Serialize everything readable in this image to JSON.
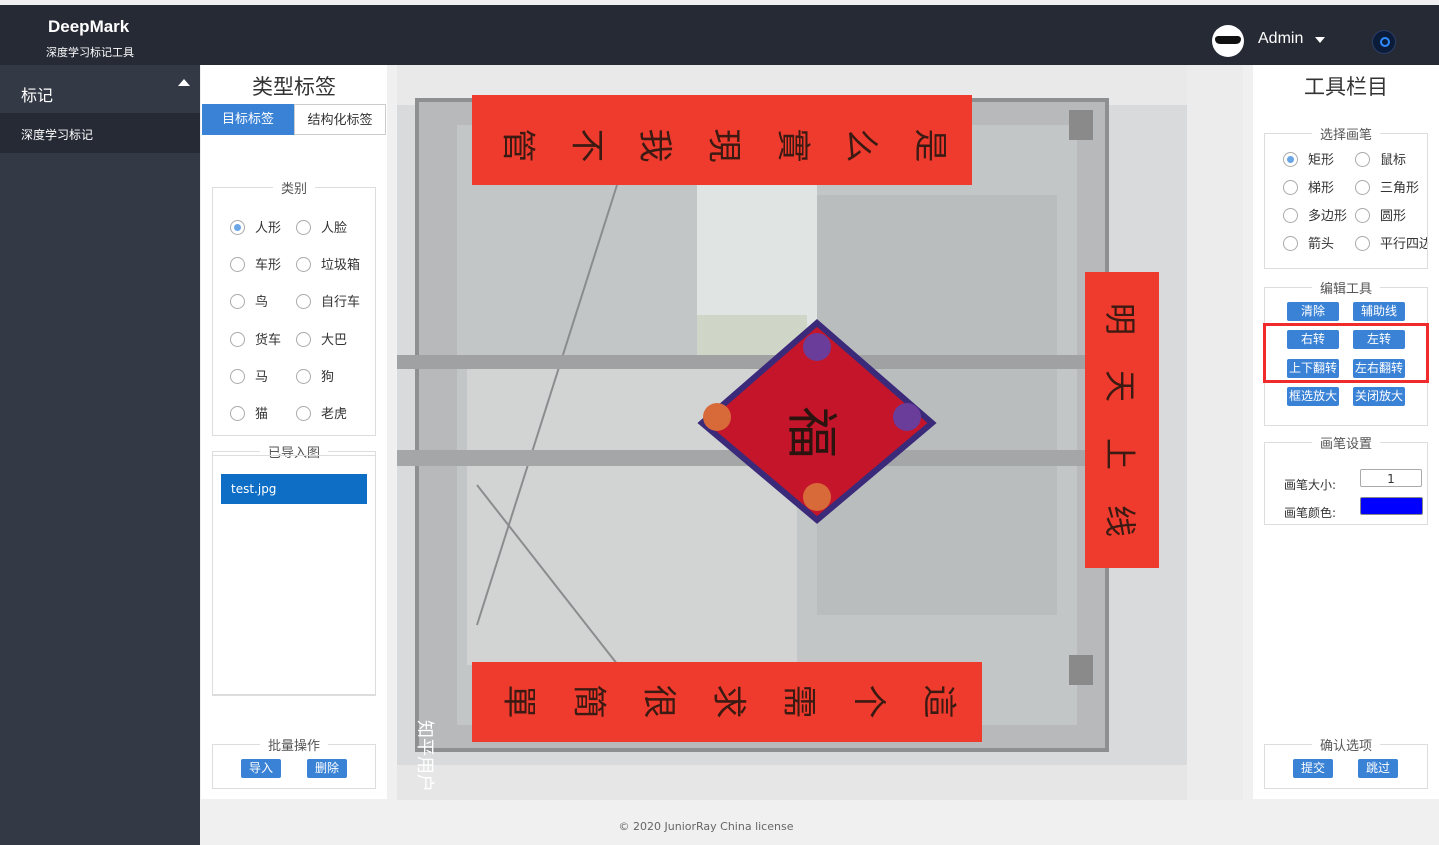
{
  "header": {
    "app_name": "DeepMark",
    "app_subtitle": "深度学习标记工具",
    "user_name": "Admin"
  },
  "sidebar": {
    "section_title": "标记",
    "items": [
      {
        "label": "深度学习标记"
      }
    ]
  },
  "left_panel": {
    "title": "类型标签",
    "tabs": [
      {
        "label": "目标标签",
        "active": true
      },
      {
        "label": "结构化标签",
        "active": false
      }
    ],
    "category_legend": "类别",
    "categories": [
      {
        "label": "人形",
        "checked": true
      },
      {
        "label": "人脸",
        "checked": false
      },
      {
        "label": "车形",
        "checked": false
      },
      {
        "label": "垃圾箱",
        "checked": false
      },
      {
        "label": "鸟",
        "checked": false
      },
      {
        "label": "自行车",
        "checked": false
      },
      {
        "label": "货车",
        "checked": false
      },
      {
        "label": "大巴",
        "checked": false
      },
      {
        "label": "马",
        "checked": false
      },
      {
        "label": "狗",
        "checked": false
      },
      {
        "label": "猫",
        "checked": false
      },
      {
        "label": "老虎",
        "checked": false
      }
    ],
    "imported_legend": "已导入图",
    "files": [
      {
        "name": "test.jpg",
        "selected": true
      }
    ],
    "batch_legend": "批量操作",
    "import_button": "导入",
    "delete_button": "删除"
  },
  "canvas": {
    "watermark": "知平用户",
    "couplet_top": [
      "是",
      "么",
      "實",
      "現",
      "我",
      "不",
      "管"
    ],
    "couplet_bottom": [
      "這",
      "个",
      "需",
      "求",
      "很",
      "簡",
      "單"
    ],
    "banner": [
      "明",
      "天",
      "上",
      "线"
    ],
    "fu_char": "福"
  },
  "right_panel": {
    "title": "工具栏目",
    "brush_legend": "选择画笔",
    "brushes": [
      {
        "label": "矩形",
        "checked": true
      },
      {
        "label": "鼠标",
        "checked": false
      },
      {
        "label": "梯形",
        "checked": false
      },
      {
        "label": "三角形",
        "checked": false
      },
      {
        "label": "多边形",
        "checked": false
      },
      {
        "label": "圆形",
        "checked": false
      },
      {
        "label": "箭头",
        "checked": false
      },
      {
        "label": "平行四边形",
        "checked": false
      }
    ],
    "edit_legend": "编辑工具",
    "edit_buttons": [
      "清除",
      "辅助线",
      "右转",
      "左转",
      "上下翻转",
      "左右翻转",
      "框选放大",
      "关闭放大"
    ],
    "pen_legend": "画笔设置",
    "pen_size_label": "画笔大小:",
    "pen_size_value": "1",
    "pen_color_label": "画笔颜色:",
    "pen_color": "#0000ff",
    "confirm_legend": "确认选项",
    "submit_button": "提交",
    "skip_button": "跳过"
  },
  "footer": {
    "text": "© 2020  JuniorRay   China license"
  },
  "colors": {
    "topbar": "#262a35",
    "sidebar": "#343946",
    "accent": "#3a82d6",
    "highlight": "#ef2b2b"
  }
}
